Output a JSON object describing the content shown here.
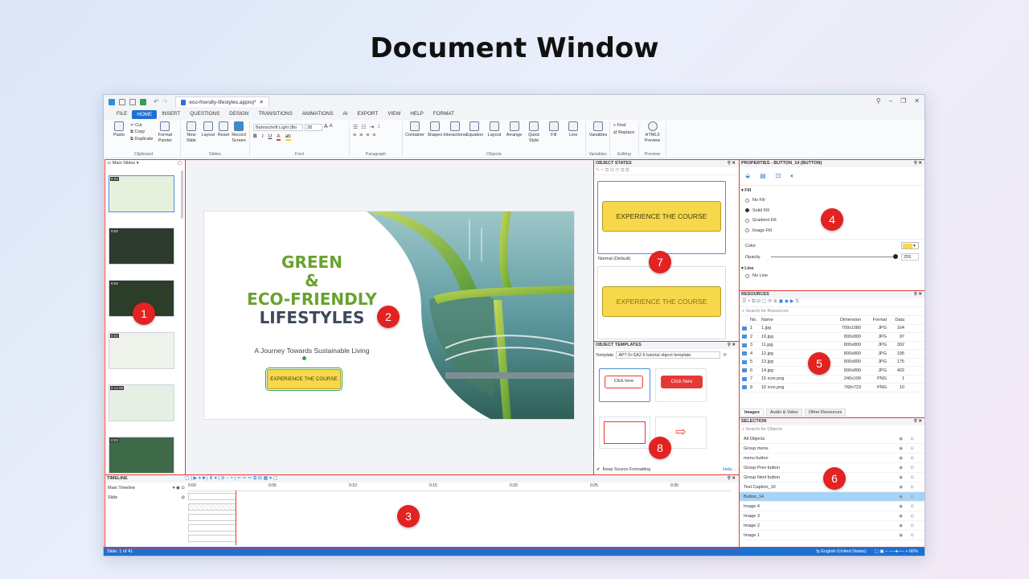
{
  "heading": "Document Window",
  "window": {
    "doc_tab": "eco-friendly-lifestyles.approj*",
    "menu": [
      "FILE",
      "HOME",
      "INSERT",
      "QUESTIONS",
      "DESIGN",
      "TRANSITIONS",
      "ANIMATIONS",
      "AI",
      "EXPORT",
      "VIEW",
      "HELP",
      "FORMAT"
    ],
    "active_menu": "HOME",
    "ribbon": {
      "clipboard": {
        "paste": "Paste",
        "cut": "Cut",
        "copy": "Copy",
        "duplicate": "Duplicate",
        "format_painter": "Format Painter",
        "label": "Clipboard"
      },
      "slides": {
        "new_slide": "New Slide",
        "layout": "Layout",
        "reset": "Reset",
        "record_screen": "Record Screen",
        "label": "Slides"
      },
      "font": {
        "family": "Bahnschrift Light (Bo",
        "size": "28",
        "label": "Font"
      },
      "paragraph": {
        "label": "Paragraph"
      },
      "objects": {
        "items": [
          "Container",
          "Shapes",
          "Interactions",
          "Equation",
          "Layout",
          "Arrange",
          "Quick Style",
          "Fill",
          "Line"
        ],
        "label": "Objects"
      },
      "variables": {
        "btn": "Variables",
        "label": "Variables"
      },
      "editing": {
        "find": "Find",
        "replace": "Replace",
        "label": "Editing"
      },
      "preview": {
        "btn": "HTML5 Preview",
        "label": "Preview"
      }
    },
    "slides_panel": {
      "title": "Main Slides",
      "thumbs": [
        {
          "time": "0:03",
          "num": "1"
        },
        {
          "time": "0:03",
          "num": "2"
        },
        {
          "time": "0:03",
          "num": "3"
        },
        {
          "time": "0:03",
          "num": "4"
        },
        {
          "time": "0:14.08",
          "num": "5"
        },
        {
          "time": "0:03",
          "num": "6"
        }
      ]
    },
    "slide": {
      "title1": "GREEN",
      "amp": "&",
      "title2": "ECO-FRIENDLY",
      "title3": "LIFESTYLES",
      "subtitle": "A Journey Towards Sustainable Living",
      "button": "EXPERIENCE THE COURSE"
    },
    "object_states": {
      "title": "OBJECT STATES",
      "state1_label": "Normal (Default)",
      "button": "EXPERIENCE THE COURSE"
    },
    "object_templates": {
      "title": "OBJECT TEMPLATES",
      "template_label": "Template",
      "template_value": "AP7.5+SA2.6 tutorial object template",
      "click1": "Click here",
      "click2": "Click here",
      "keep": "Keep Source Formatting",
      "help": "Help..."
    },
    "properties": {
      "title": "PROPERTIES - BUTTON_14 (BUTTON)",
      "fill": "Fill",
      "options": [
        "No Fill",
        "Solid Fill",
        "Gradient Fill",
        "Image Fill"
      ],
      "selected": "Solid Fill",
      "color_label": "Color",
      "opacity_label": "Opacity",
      "opacity_value": "255",
      "line": "Line",
      "no_line": "No Line",
      "accent": "#f7d84a"
    },
    "resources": {
      "title": "RESOURCES",
      "search": "Search for Resources",
      "cols": [
        "No.",
        "Name",
        "Dimension",
        "Format",
        "Data"
      ],
      "rows": [
        [
          "1",
          "1.jpg",
          "700x1080",
          "JPG",
          "164"
        ],
        [
          "2",
          "10.jpg",
          "800x800",
          "JPG",
          "97"
        ],
        [
          "3",
          "11.jpg",
          "800x800",
          "JPG",
          "302"
        ],
        [
          "4",
          "12.jpg",
          "800x800",
          "JPG",
          "195"
        ],
        [
          "5",
          "13.jpg",
          "800x800",
          "JPG",
          "175"
        ],
        [
          "6",
          "14.jpg",
          "800x800",
          "JPG",
          "402"
        ],
        [
          "7",
          "15 icon.png",
          "240x199",
          "PNG",
          "1"
        ],
        [
          "8",
          "16 icon.png",
          "768x723",
          "PNG",
          "10"
        ]
      ],
      "tabs": [
        "Images",
        "Audio & Video",
        "Other Resources"
      ]
    },
    "selection": {
      "title": "SELECTION",
      "search": "Search for Objects",
      "items": [
        "All Objects",
        "Group menu",
        "menu button",
        "Group Prev button",
        "Group Next button",
        "Text Caption_16",
        "Button_14",
        "Image 4",
        "Image 3",
        "Image 2",
        "Image 1"
      ],
      "selected": "Button_14"
    },
    "timeline": {
      "title": "TIMELINE",
      "main": "Main Timeline",
      "slide": "Slide",
      "ticks": [
        "0:00",
        "0:05",
        "0:10",
        "0:15",
        "0:20",
        "0:25",
        "0:30"
      ]
    },
    "status": {
      "left": "Slide: 1 of 41",
      "lang": "English (United States)",
      "zoom": "60%"
    },
    "markers": [
      "1",
      "2",
      "3",
      "4",
      "5",
      "6",
      "7",
      "8"
    ]
  }
}
